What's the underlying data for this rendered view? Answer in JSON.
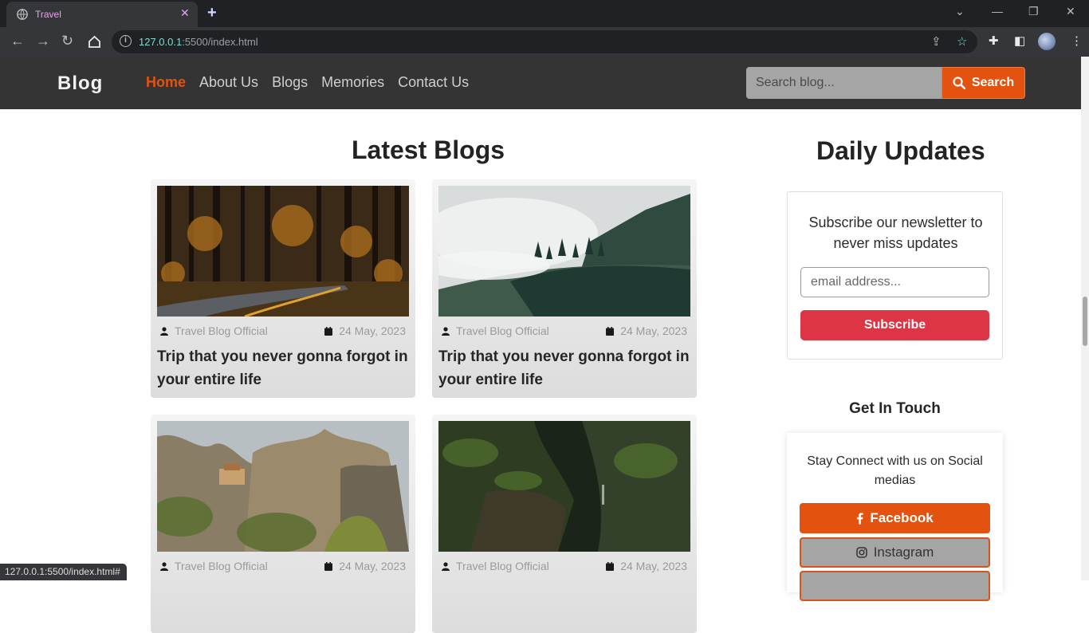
{
  "browser": {
    "tab_title": "Travel",
    "url_host": "127.0.0.1",
    "url_rest": ":5500/index.html",
    "status_url": "127.0.0.1:5500/index.html#"
  },
  "nav": {
    "brand": "Blog",
    "links": [
      "Home",
      "About Us",
      "Blogs",
      "Memories",
      "Contact Us"
    ],
    "search_placeholder": "Search blog...",
    "search_label": "Search"
  },
  "main": {
    "heading": "Latest Blogs",
    "cards": [
      {
        "author": "Travel Blog Official",
        "date": "24 May, 2023",
        "title": "Trip that you never gonna forgot in your entire life"
      },
      {
        "author": "Travel Blog Official",
        "date": "24 May, 2023",
        "title": "Trip that you never gonna forgot in your entire life"
      },
      {
        "author": "Travel Blog Official",
        "date": "24 May, 2023",
        "title": ""
      },
      {
        "author": "Travel Blog Official",
        "date": "24 May, 2023",
        "title": ""
      }
    ]
  },
  "sidebar": {
    "heading": "Daily Updates",
    "newsletter_text": "Subscribe our newsletter to never miss updates",
    "email_placeholder": "email address...",
    "subscribe_label": "Subscribe",
    "touch_title": "Get In Touch",
    "social_text": "Stay Connect with us on Social medias",
    "facebook_label": "Facebook",
    "instagram_label": "Instagram"
  },
  "colors": {
    "accent": "#e4520f",
    "danger": "#dc3545",
    "nav_bg": "#343434"
  }
}
